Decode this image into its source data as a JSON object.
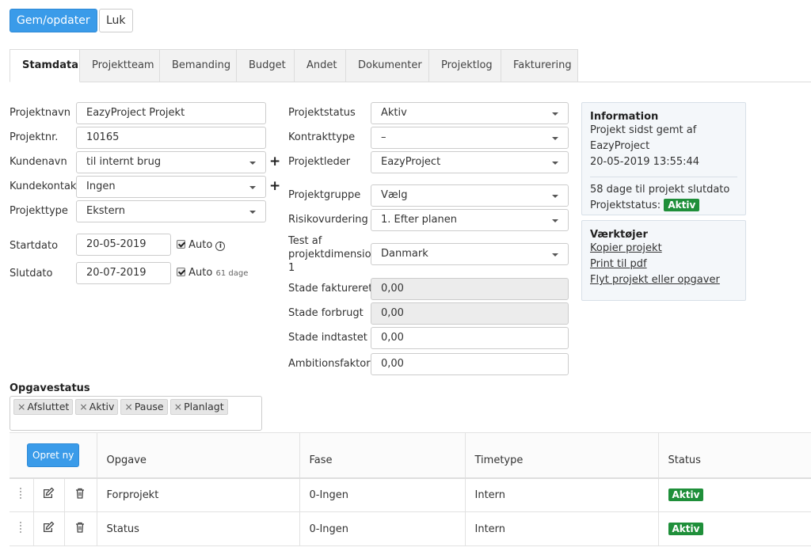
{
  "toolbar": {
    "save_label": "Gem/opdater",
    "close_label": "Luk"
  },
  "tabs": [
    "Stamdata",
    "Projektteam",
    "Bemanding",
    "Budget",
    "Andet",
    "Dokumenter",
    "Projektlog",
    "Fakturering"
  ],
  "form_left": {
    "projektnavn": {
      "label": "Projektnavn",
      "value": "EazyProject Projekt"
    },
    "projektnr": {
      "label": "Projektnr.",
      "value": "10165"
    },
    "kundenavn": {
      "label": "Kundenavn",
      "value": "til internt brug"
    },
    "kundekontakt": {
      "label": "Kundekontakt",
      "value": "Ingen"
    },
    "projekttype": {
      "label": "Projekttype",
      "value": "Ekstern"
    },
    "startdato": {
      "label": "Startdato",
      "value": "20-05-2019",
      "auto_label": "Auto"
    },
    "slutdato": {
      "label": "Slutdato",
      "value": "20-07-2019",
      "auto_label": "Auto",
      "days_note": "61 dage"
    }
  },
  "form_mid": {
    "projektstatus": {
      "label": "Projektstatus",
      "value": "Aktiv"
    },
    "kontrakttype": {
      "label": "Kontrakttype",
      "value": "–"
    },
    "projektleder": {
      "label": "Projektleder",
      "value": "EazyProject"
    },
    "projektgruppe": {
      "label": "Projektgruppe",
      "value": "Vælg"
    },
    "risikovurdering": {
      "label": "Risikovurdering",
      "value": "1. Efter planen"
    },
    "dimension": {
      "label_lines": [
        "Test af",
        "projektdimension",
        "1"
      ],
      "value": "Danmark"
    },
    "stade_faktureret": {
      "label": "Stade faktureret",
      "value": "0,00"
    },
    "stade_forbrugt": {
      "label": "Stade forbrugt",
      "value": "0,00"
    },
    "stade_indtastet": {
      "label": "Stade indtastet",
      "value": "0,00"
    },
    "ambitionsfaktor": {
      "label": "Ambitionsfaktor",
      "value": "0,00"
    }
  },
  "info_panel": {
    "title": "Information",
    "line1": "Projekt sidst gemt af",
    "line2": "EazyProject",
    "line3": "20-05-2019 13:55:44",
    "days_left": "58 dage til projekt slutdato",
    "status_label": "Projektstatus:",
    "status_badge": "Aktiv"
  },
  "tools_panel": {
    "title": "Værktøjer",
    "links": [
      "Kopier projekt",
      "Print til pdf",
      "Flyt projekt eller opgaver"
    ]
  },
  "opgavestatus": {
    "label": "Opgavestatus",
    "tags": [
      "Afsluttet",
      "Aktiv",
      "Pause",
      "Planlagt"
    ]
  },
  "task_table": {
    "create_button": "Opret ny",
    "columns": [
      "Opgave",
      "Fase",
      "Timetype",
      "Status"
    ],
    "rows": [
      {
        "opgave": "Forprojekt",
        "fase": "0-Ingen",
        "timetype": "Intern",
        "status": "Aktiv"
      },
      {
        "opgave": "Status",
        "fase": "0-Ingen",
        "timetype": "Intern",
        "status": "Aktiv"
      }
    ]
  },
  "colors": {
    "primary": "#3a9be9",
    "status_green": "#1f8f3a"
  }
}
